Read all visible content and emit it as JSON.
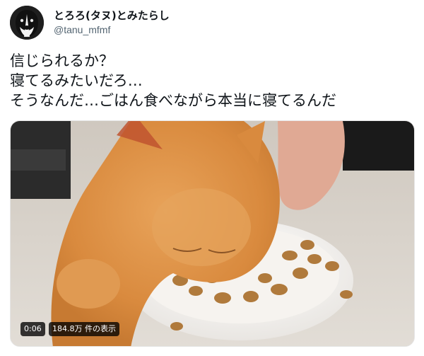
{
  "author": {
    "display_name": "とろろ(タヌ)とみたらし",
    "handle": "@tanu_mfmf",
    "avatar_icon": "dog-avatar-icon"
  },
  "tweet": {
    "lines": [
      "信じられるか？",
      "寝てるみたいだろ…",
      "そうなんだ…ごはん食べながら本当に寝てるんだ"
    ]
  },
  "media": {
    "duration": "0:06",
    "views": "184.8万 件の表示"
  },
  "colors": {
    "text": "#0f1419",
    "secondary": "#536471",
    "badge_bg": "rgba(0,0,0,0.78)"
  }
}
